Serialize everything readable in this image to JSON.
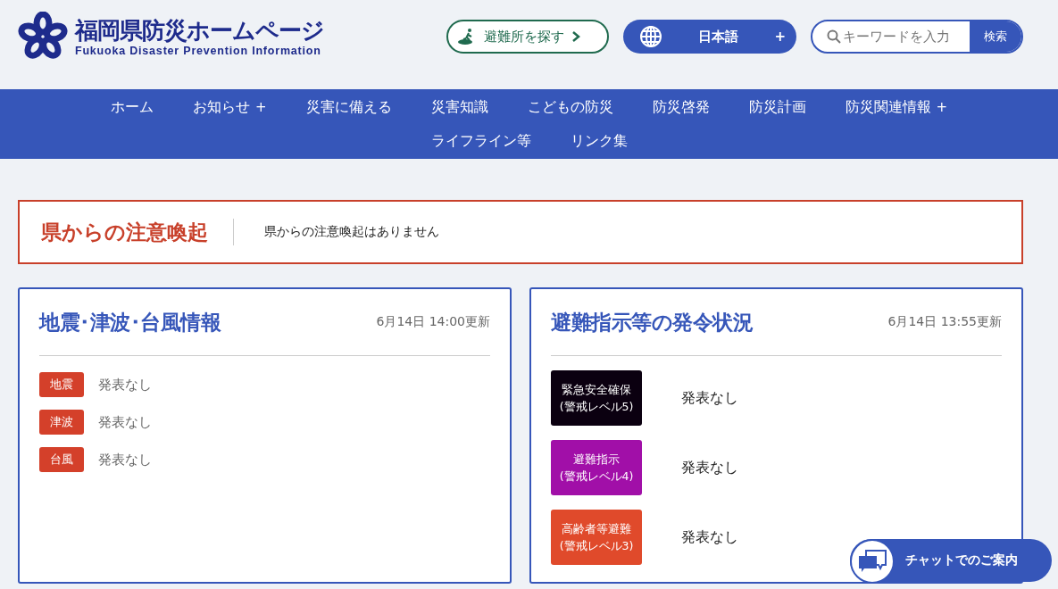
{
  "header": {
    "title": "福岡県防災ホームページ",
    "subtitle": "Fukuoka Disaster Prevention Information",
    "shelter_button": "避難所を探す",
    "language": {
      "label": "日本語",
      "toggle": "+"
    },
    "search": {
      "placeholder": "キーワードを入力",
      "button": "検索"
    }
  },
  "nav": [
    {
      "label": "ホーム"
    },
    {
      "label": "お知らせ",
      "toggle": "+"
    },
    {
      "label": "災害に備える"
    },
    {
      "label": "災害知識"
    },
    {
      "label": "こどもの防災"
    },
    {
      "label": "防災啓発"
    },
    {
      "label": "防災計画"
    },
    {
      "label": "防災関連情報",
      "toggle": "+"
    },
    {
      "label": "ライフライン等"
    },
    {
      "label": "リンク集"
    }
  ],
  "alert": {
    "title": "県からの注意喚起",
    "message": "県からの注意喚起はありません"
  },
  "cards": [
    {
      "title": "地震･津波･台風情報",
      "updated": "6月14日 14:00更新",
      "kind": "tags",
      "items": [
        {
          "label": "地震",
          "status": "発表なし",
          "color": "#d4402a"
        },
        {
          "label": "津波",
          "status": "発表なし",
          "color": "#d4402a"
        },
        {
          "label": "台風",
          "status": "発表なし",
          "color": "#d4402a"
        }
      ]
    },
    {
      "title": "避難指示等の発令状況",
      "updated": "6月14日 13:55更新",
      "kind": "levels",
      "items": [
        {
          "label": "緊急安全確保",
          "sub": "(警戒レベル5)",
          "status": "発表なし",
          "color": "#0b0010"
        },
        {
          "label": "避難指示",
          "sub": "(警戒レベル4)",
          "status": "発表なし",
          "color": "#a10fa8"
        },
        {
          "label": "高齢者等避難",
          "sub": "(警戒レベル3)",
          "status": "発表なし",
          "color": "#e04a2b"
        }
      ]
    }
  ],
  "chat_button": "チャットでのご案内"
}
